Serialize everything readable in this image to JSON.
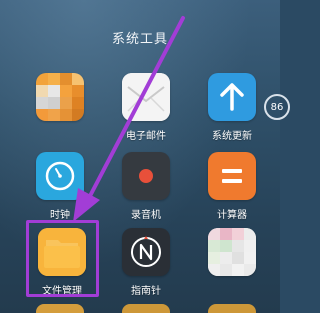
{
  "folder": {
    "title": "系统工具"
  },
  "apps": [
    {
      "id": "blurred-app-1",
      "label": "",
      "icon": "mosaic-orange-icon"
    },
    {
      "id": "email",
      "label": "电子邮件",
      "icon": "mail-envelope-icon"
    },
    {
      "id": "system-update",
      "label": "系统更新",
      "icon": "arrow-up-icon"
    },
    {
      "id": "clock",
      "label": "时钟",
      "icon": "clock-icon"
    },
    {
      "id": "recorder",
      "label": "录音机",
      "icon": "record-dot-icon"
    },
    {
      "id": "calculator",
      "label": "计算器",
      "icon": "equals-icon"
    },
    {
      "id": "file-manager",
      "label": "文件管理",
      "icon": "folder-icon"
    },
    {
      "id": "compass",
      "label": "指南针",
      "icon": "compass-n-icon"
    },
    {
      "id": "blurred-app-2",
      "label": "",
      "icon": "mosaic-white-icon"
    }
  ],
  "badge": {
    "text": "86"
  },
  "colors": {
    "highlight": "#a23dd6",
    "arrow": "#a23dd6",
    "calculator": "#f07a2e",
    "update": "#2f9be0",
    "clock": "#2aa7de",
    "recorder": "#353a40",
    "folder": "#f8b43c",
    "compass": "#2a2f36"
  }
}
